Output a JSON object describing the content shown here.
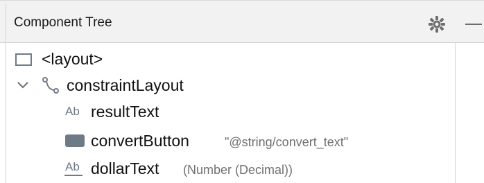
{
  "panel": {
    "title": "Component Tree"
  },
  "tree": {
    "items": [
      {
        "label": "<layout>",
        "secondary": "",
        "icon": "layout-rectangle-icon"
      },
      {
        "label": "constraintLayout",
        "secondary": "",
        "icon": "constraint-layout-icon",
        "expanded": true
      },
      {
        "label": "resultText",
        "secondary": "",
        "icon": "text-view-icon",
        "icon_text": "Ab"
      },
      {
        "label": "convertButton",
        "secondary": "\"@string/convert_text\"",
        "icon": "button-icon"
      },
      {
        "label": "dollarText",
        "secondary": "(Number (Decimal))",
        "icon": "edit-text-icon",
        "icon_text": "Ab"
      }
    ]
  },
  "colors": {
    "header_bg": "#f2f2f2",
    "icon_gray": "#6f7a87",
    "secondary_text": "#6f6f6f"
  }
}
